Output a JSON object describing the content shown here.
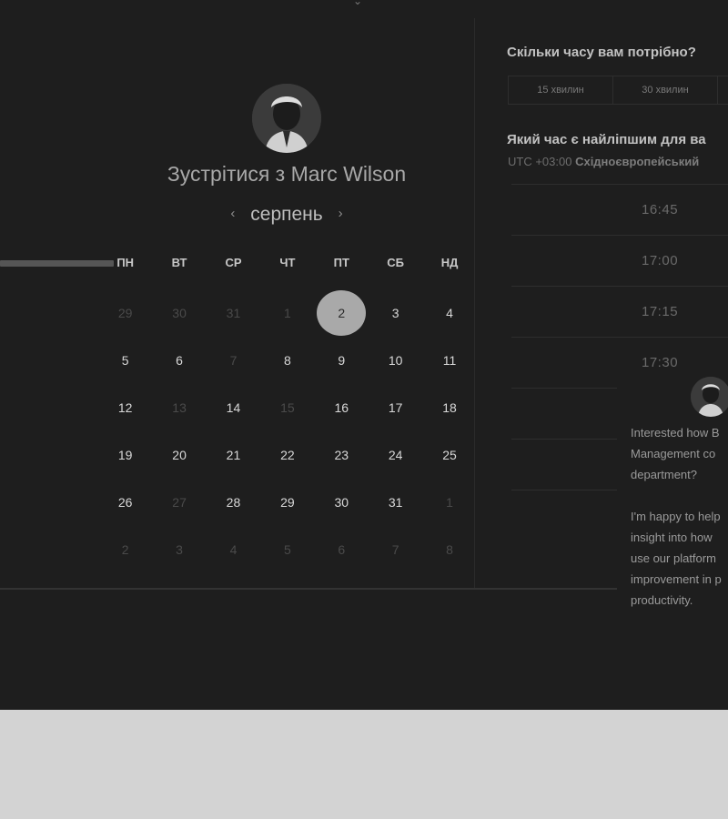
{
  "calendar": {
    "title": "Зустрітися з Marc Wilson",
    "month": "серпень",
    "weekdays": [
      "ПН",
      "ВТ",
      "СР",
      "ЧТ",
      "ПТ",
      "СБ",
      "НД"
    ],
    "selected_day": "2",
    "weeks": [
      [
        {
          "d": "29",
          "s": "muted"
        },
        {
          "d": "30",
          "s": "muted"
        },
        {
          "d": "31",
          "s": "muted"
        },
        {
          "d": "1",
          "s": "muted"
        },
        {
          "d": "2",
          "s": "selected"
        },
        {
          "d": "3",
          "s": "active"
        },
        {
          "d": "4",
          "s": "active"
        }
      ],
      [
        {
          "d": "5",
          "s": "active"
        },
        {
          "d": "6",
          "s": "active"
        },
        {
          "d": "7",
          "s": "muted"
        },
        {
          "d": "8",
          "s": "active"
        },
        {
          "d": "9",
          "s": "active"
        },
        {
          "d": "10",
          "s": "active"
        },
        {
          "d": "11",
          "s": "active"
        }
      ],
      [
        {
          "d": "12",
          "s": "active"
        },
        {
          "d": "13",
          "s": "muted"
        },
        {
          "d": "14",
          "s": "active"
        },
        {
          "d": "15",
          "s": "muted"
        },
        {
          "d": "16",
          "s": "active"
        },
        {
          "d": "17",
          "s": "active"
        },
        {
          "d": "18",
          "s": "active"
        }
      ],
      [
        {
          "d": "19",
          "s": "active"
        },
        {
          "d": "20",
          "s": "active"
        },
        {
          "d": "21",
          "s": "active"
        },
        {
          "d": "22",
          "s": "active"
        },
        {
          "d": "23",
          "s": "active"
        },
        {
          "d": "24",
          "s": "active"
        },
        {
          "d": "25",
          "s": "active"
        }
      ],
      [
        {
          "d": "26",
          "s": "active"
        },
        {
          "d": "27",
          "s": "muted"
        },
        {
          "d": "28",
          "s": "active"
        },
        {
          "d": "29",
          "s": "active"
        },
        {
          "d": "30",
          "s": "active"
        },
        {
          "d": "31",
          "s": "active"
        },
        {
          "d": "1",
          "s": "muted"
        }
      ],
      [
        {
          "d": "2",
          "s": "muted"
        },
        {
          "d": "3",
          "s": "muted"
        },
        {
          "d": "4",
          "s": "muted"
        },
        {
          "d": "5",
          "s": "muted"
        },
        {
          "d": "6",
          "s": "muted"
        },
        {
          "d": "7",
          "s": "muted"
        },
        {
          "d": "8",
          "s": "muted"
        }
      ]
    ]
  },
  "scheduler": {
    "duration_question": "Скільки часу вам потрібно?",
    "durations": [
      "15 хвилин",
      "30 хвилин"
    ],
    "time_question": "Який час є найліпшим для ва",
    "timezone_offset": "UTC +03:00",
    "timezone_name": "Східноєвропейський",
    "slots": [
      "16:45",
      "17:00",
      "17:15",
      "17:30"
    ]
  },
  "chat": {
    "message": "Interested how B\nManagement co\ndepartment?\n\nI'm happy to help\ninsight into how\nuse our platform\nimprovement in p\nproductivity."
  },
  "colors": {
    "background": "#1e1e1e",
    "outer": "#d3d3d3",
    "selected_day": "#a9a9a9"
  }
}
